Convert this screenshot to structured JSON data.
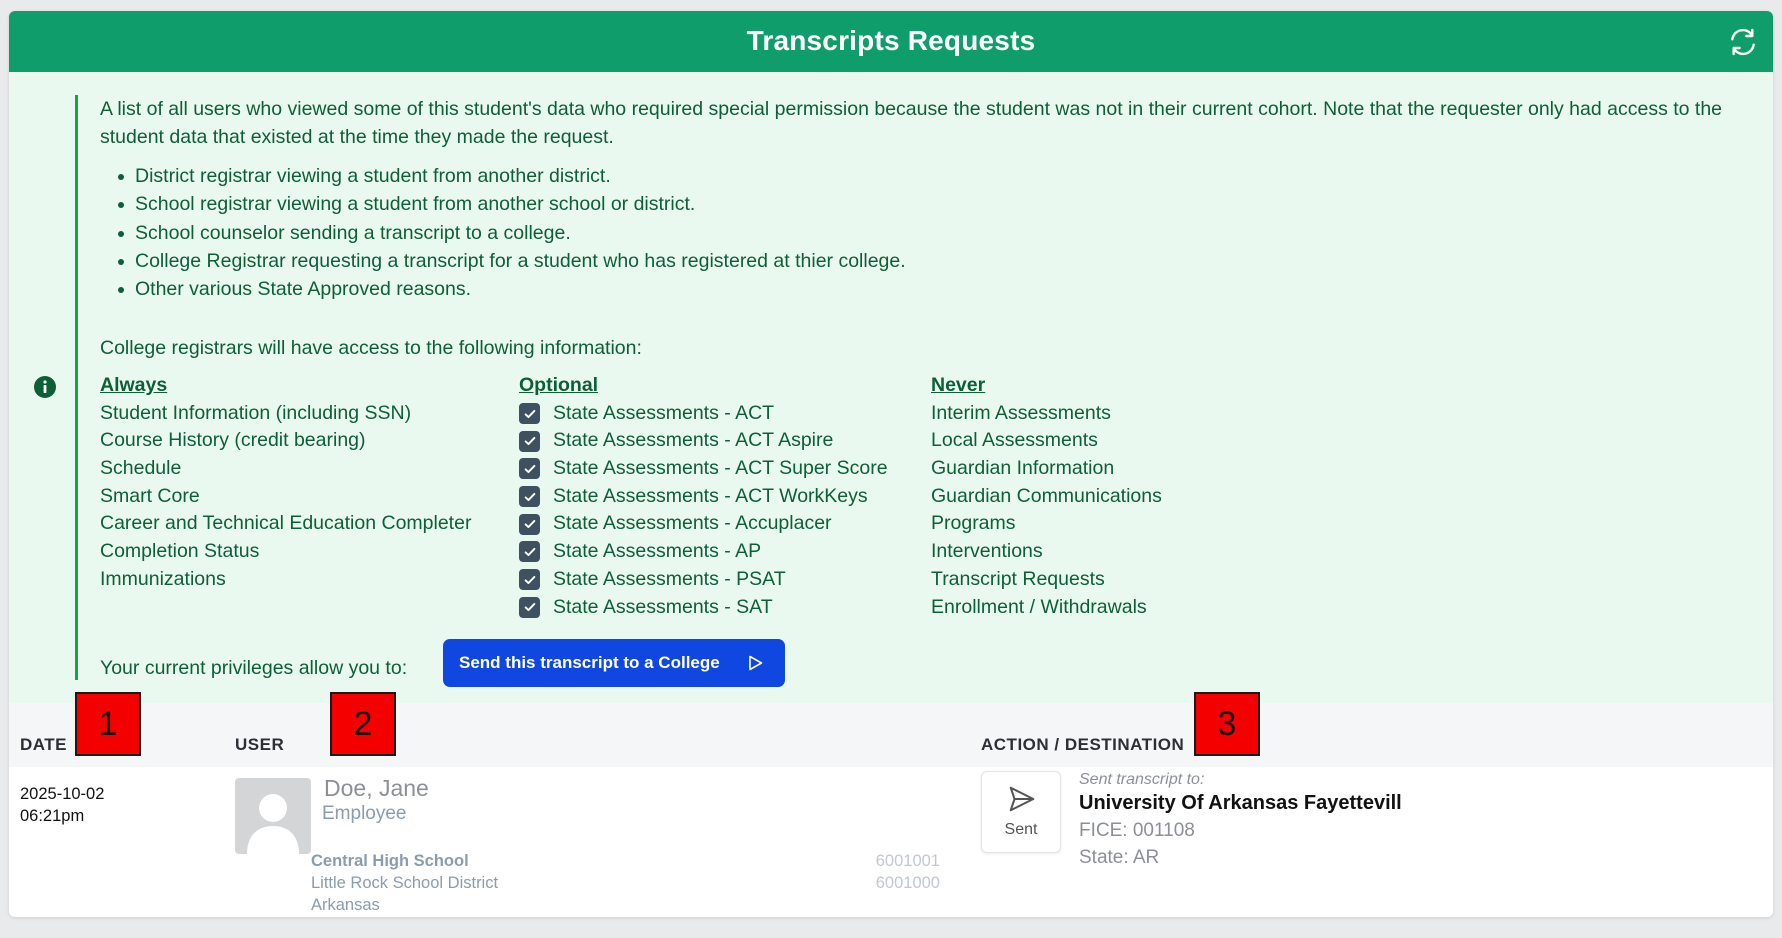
{
  "header": {
    "title": "Transcripts Requests",
    "refresh_icon": "refresh-icon"
  },
  "info": {
    "intro": "A list of all users who viewed some of this student's data who required special permission because the student was not in their current cohort. Note that the requester only had access to the student data that existed at the time they made the request.",
    "bullets": [
      "District registrar viewing a student from another district.",
      "School registrar viewing a student from another school or district.",
      "School counselor sending a transcript to a college.",
      "College Registrar requesting a transcript for a student who has registered at thier college.",
      "Other various State Approved reasons."
    ],
    "access_lead": "College registrars will have access to the following information:",
    "always": {
      "heading": "Always",
      "items": [
        "Student Information (including SSN)",
        "Course History (credit bearing)",
        "Schedule",
        "Smart Core",
        "Career and Technical Education Completer",
        "Completion Status",
        "Immunizations"
      ]
    },
    "optional": {
      "heading": "Optional",
      "items": [
        {
          "label": "State Assessments - ACT",
          "checked": true
        },
        {
          "label": "State Assessments - ACT Aspire",
          "checked": true
        },
        {
          "label": "State Assessments - ACT Super Score",
          "checked": true
        },
        {
          "label": "State Assessments - ACT WorkKeys",
          "checked": true
        },
        {
          "label": "State Assessments - Accuplacer",
          "checked": true
        },
        {
          "label": "State Assessments - AP",
          "checked": true
        },
        {
          "label": "State Assessments - PSAT",
          "checked": true
        },
        {
          "label": "State Assessments - SAT",
          "checked": true
        }
      ]
    },
    "never": {
      "heading": "Never",
      "items": [
        "Interim Assessments",
        "Local Assessments",
        "Guardian Information",
        "Guardian Communications",
        "Programs",
        "Interventions",
        "Transcript Requests",
        "Enrollment / Withdrawals"
      ]
    },
    "privileges_label": "Your current privileges allow you to:",
    "send_button_label": "Send this transcript to a College"
  },
  "table": {
    "columns": {
      "date": "DATE",
      "user": "USER",
      "action": "ACTION / DESTINATION"
    },
    "markers": [
      "1",
      "2",
      "3"
    ],
    "rows": [
      {
        "date": "2025-10-02",
        "time": "06:21pm",
        "user_name": "Doe, Jane",
        "user_role": "Employee",
        "school": "Central High School",
        "district": "Little Rock School District",
        "state_name": "Arkansas",
        "school_code": "6001001",
        "district_code": "6001000",
        "action_label": "Sent",
        "dest_caption": "Sent transcript to:",
        "dest_name": "University Of Arkansas Fayettevill",
        "dest_fice": "FICE: 001108",
        "dest_state": "State: AR"
      }
    ]
  },
  "colors": {
    "header_bg": "#109d6c",
    "info_bg": "#eaf9ef",
    "info_text": "#0d5f38",
    "button_bg": "#1047e0",
    "marker_bg": "#f50000"
  }
}
